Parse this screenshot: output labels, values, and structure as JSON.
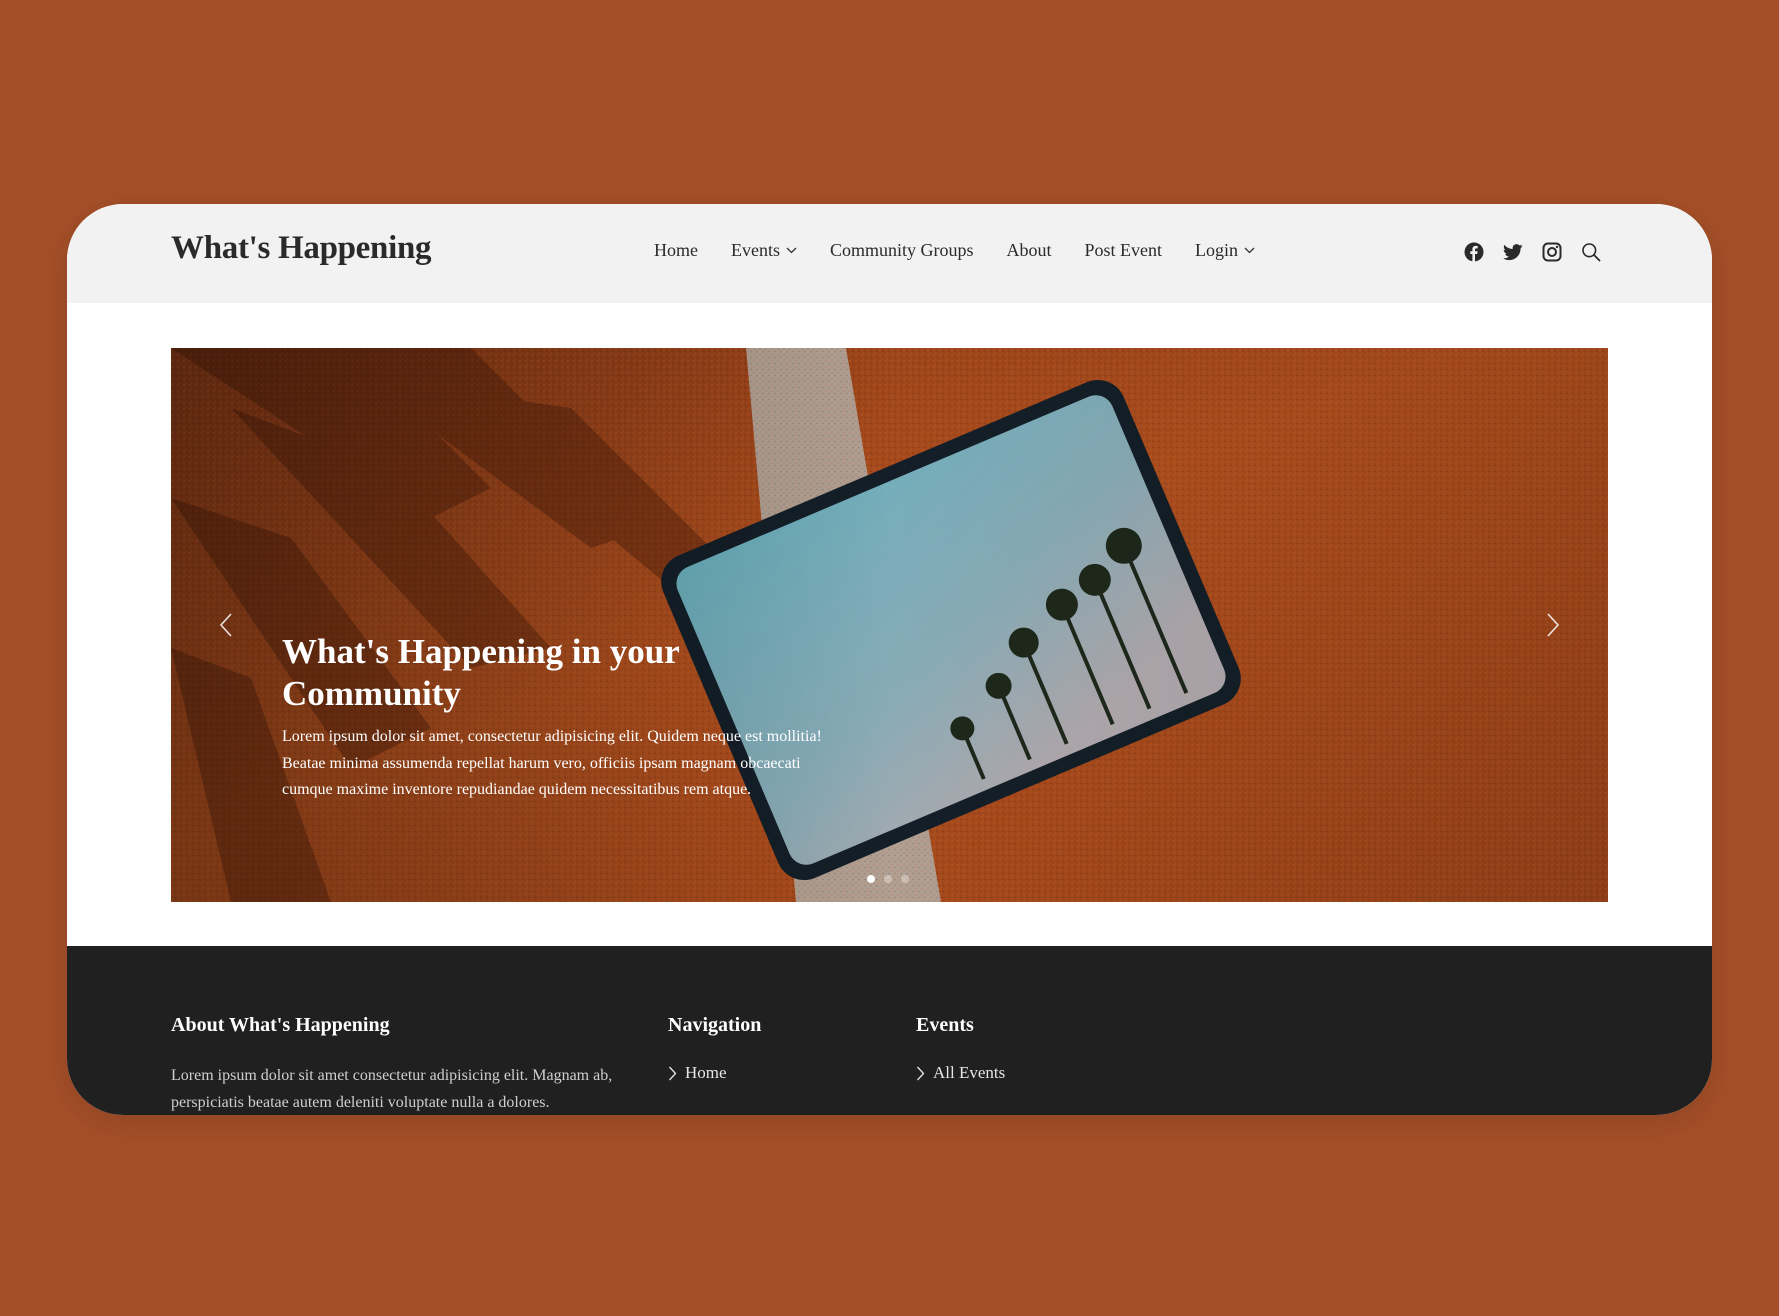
{
  "site": {
    "logo": "What's Happening"
  },
  "nav": {
    "items": [
      {
        "label": "Home",
        "dropdown": false
      },
      {
        "label": "Events",
        "dropdown": true
      },
      {
        "label": "Community Groups",
        "dropdown": false
      },
      {
        "label": "About",
        "dropdown": false
      },
      {
        "label": "Post Event",
        "dropdown": false
      },
      {
        "label": "Login",
        "dropdown": true
      }
    ]
  },
  "social": {
    "icons": [
      "facebook-icon",
      "twitter-icon",
      "instagram-icon",
      "search-icon"
    ]
  },
  "hero": {
    "title": "What's Happening in your Community",
    "text": "Lorem ipsum dolor sit amet, consectetur adipisicing elit. Quidem neque est mollitia! Beatae minima assumenda repellat harum vero, officiis ipsam magnam obcaecati cumque maxime inventore repudiandae quidem necessitatibus rem atque.",
    "slides": 3,
    "active_slide": 1
  },
  "footer": {
    "about": {
      "heading": "About What's Happening",
      "text": "Lorem ipsum dolor sit amet consectetur adipisicing elit. Magnam ab, perspiciatis beatae autem deleniti voluptate nulla a dolores."
    },
    "navigation": {
      "heading": "Navigation",
      "links": [
        "Home"
      ]
    },
    "events": {
      "heading": "Events",
      "links": [
        "All Events"
      ]
    }
  },
  "colors": {
    "page_background": "#a44f28",
    "header_background": "#f2f2f2",
    "footer_background": "#202020",
    "text_dark": "#2a2a2a"
  }
}
